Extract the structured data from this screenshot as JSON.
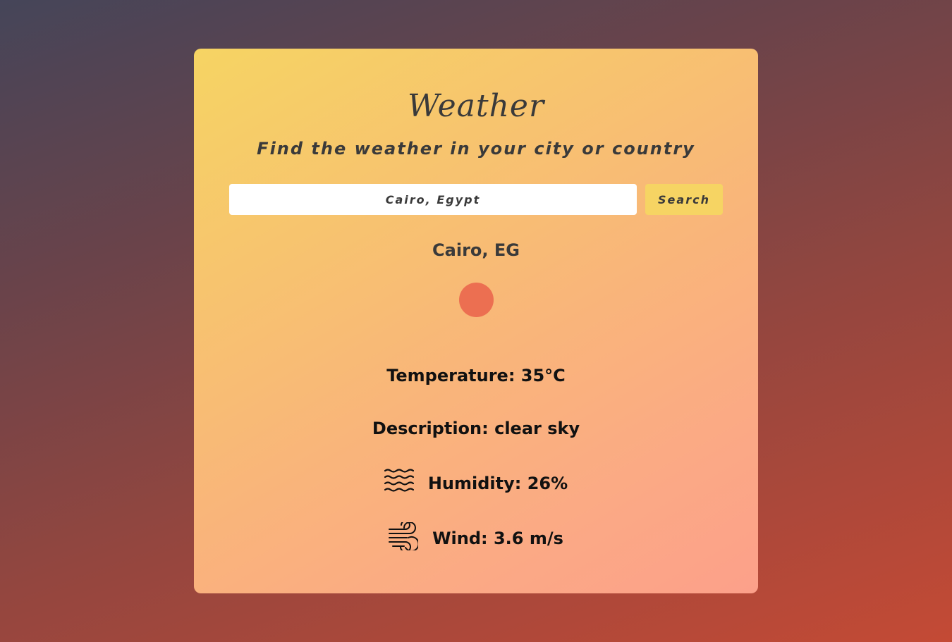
{
  "app": {
    "title": "Weather",
    "subtitle": "Find the weather in your city or country"
  },
  "search": {
    "value": "Cairo, Egypt",
    "button_label": "Search"
  },
  "result": {
    "city": "Cairo, EG",
    "weather_icon": "sun-icon",
    "temperature": "Temperature: 35°C",
    "description": "Description: clear sky",
    "humidity": "Humidity: 26%",
    "humidity_icon": "humidity-waves-icon",
    "wind": "Wind: 3.6 m/s",
    "wind_icon": "wind-icon"
  },
  "colors": {
    "card_gradient_start": "#f6d463",
    "card_gradient_end": "#fca08a",
    "sun": "#ec6f51",
    "button": "#f6d463"
  }
}
